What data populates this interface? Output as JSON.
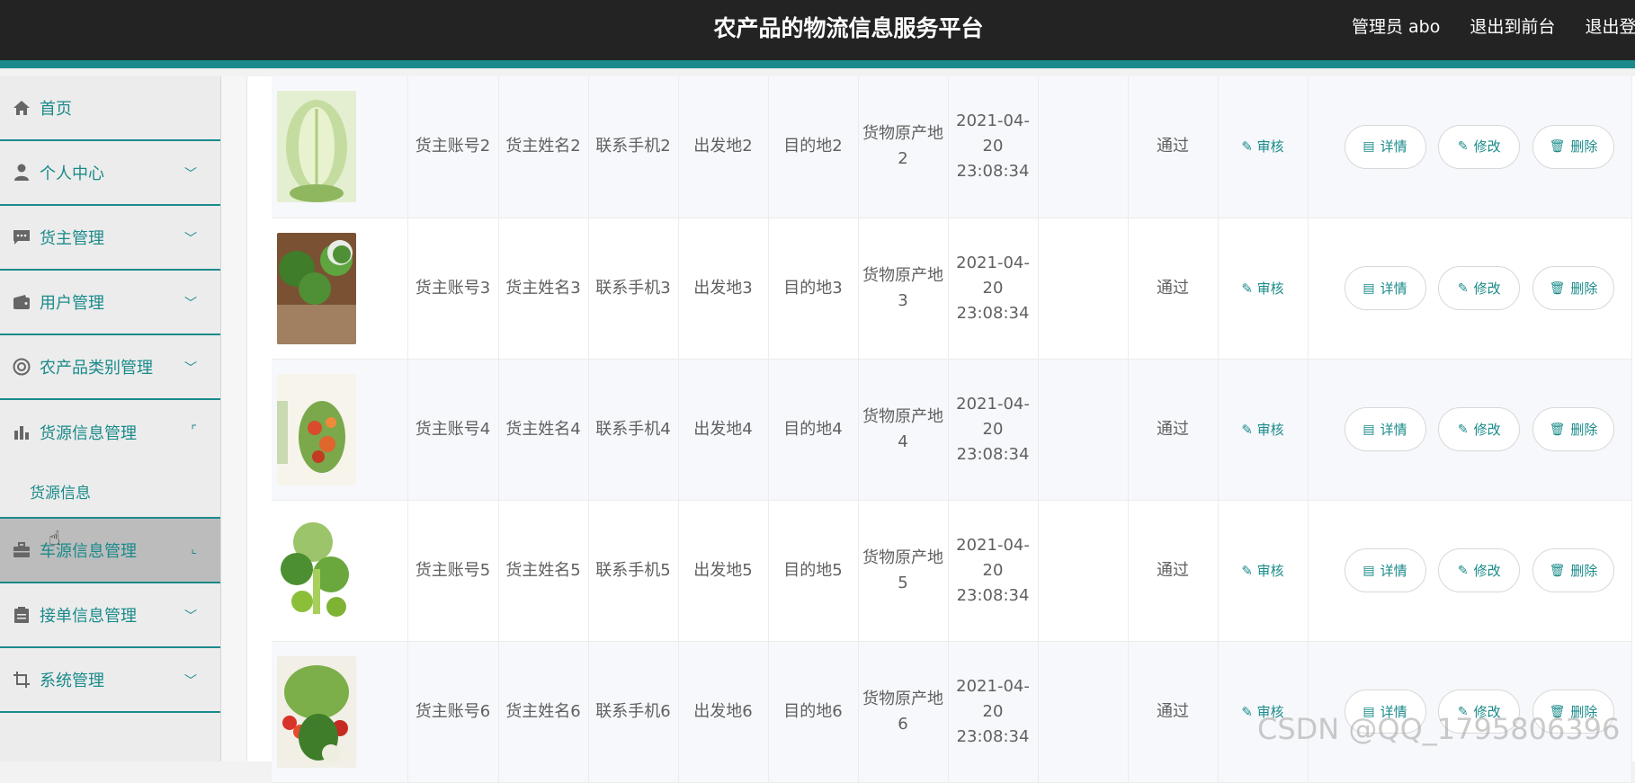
{
  "header": {
    "title": "农产品的物流信息服务平台",
    "admin_label": "管理员 abo",
    "exit_front": "退出到前台",
    "exit_login": "退出登"
  },
  "sidebar": {
    "items": [
      {
        "label": "首页",
        "icon": "home-icon"
      },
      {
        "label": "个人中心",
        "icon": "user-icon"
      },
      {
        "label": "货主管理",
        "icon": "chat-icon"
      },
      {
        "label": "用户管理",
        "icon": "wallet-icon"
      },
      {
        "label": "农产品类别管理",
        "icon": "lifebuoy-icon"
      },
      {
        "label": "货源信息管理",
        "icon": "bar-chart-icon"
      },
      {
        "label": "车源信息管理",
        "icon": "briefcase-icon"
      },
      {
        "label": "接单信息管理",
        "icon": "clipboard-icon"
      },
      {
        "label": "系统管理",
        "icon": "crop-icon"
      }
    ],
    "submenu_label": "货源信息"
  },
  "table": {
    "rows": [
      {
        "account": "货主账号2",
        "name": "货主姓名2",
        "phone": "联系手机2",
        "origin": "出发地2",
        "dest": "目的地2",
        "source": "货物原产地2",
        "time": "2021-04-20 23:08:34",
        "status": "通过"
      },
      {
        "account": "货主账号3",
        "name": "货主姓名3",
        "phone": "联系手机3",
        "origin": "出发地3",
        "dest": "目的地3",
        "source": "货物原产地3",
        "time": "2021-04-20 23:08:34",
        "status": "通过"
      },
      {
        "account": "货主账号4",
        "name": "货主姓名4",
        "phone": "联系手机4",
        "origin": "出发地4",
        "dest": "目的地4",
        "source": "货物原产地4",
        "time": "2021-04-20 23:08:34",
        "status": "通过"
      },
      {
        "account": "货主账号5",
        "name": "货主姓名5",
        "phone": "联系手机5",
        "origin": "出发地5",
        "dest": "目的地5",
        "source": "货物原产地5",
        "time": "2021-04-20 23:08:34",
        "status": "通过"
      },
      {
        "account": "货主账号6",
        "name": "货主姓名6",
        "phone": "联系手机6",
        "origin": "出发地6",
        "dest": "目的地6",
        "source": "货物原产地6",
        "time": "2021-04-20 23:08:34",
        "status": "通过"
      }
    ],
    "audit_label": "审核",
    "detail_label": "详情",
    "edit_label": "修改",
    "delete_label": "删除"
  },
  "watermark": "CSDN @QQ_1795806396",
  "colors": {
    "accent": "#1a8a8a",
    "topbar": "#232323"
  }
}
